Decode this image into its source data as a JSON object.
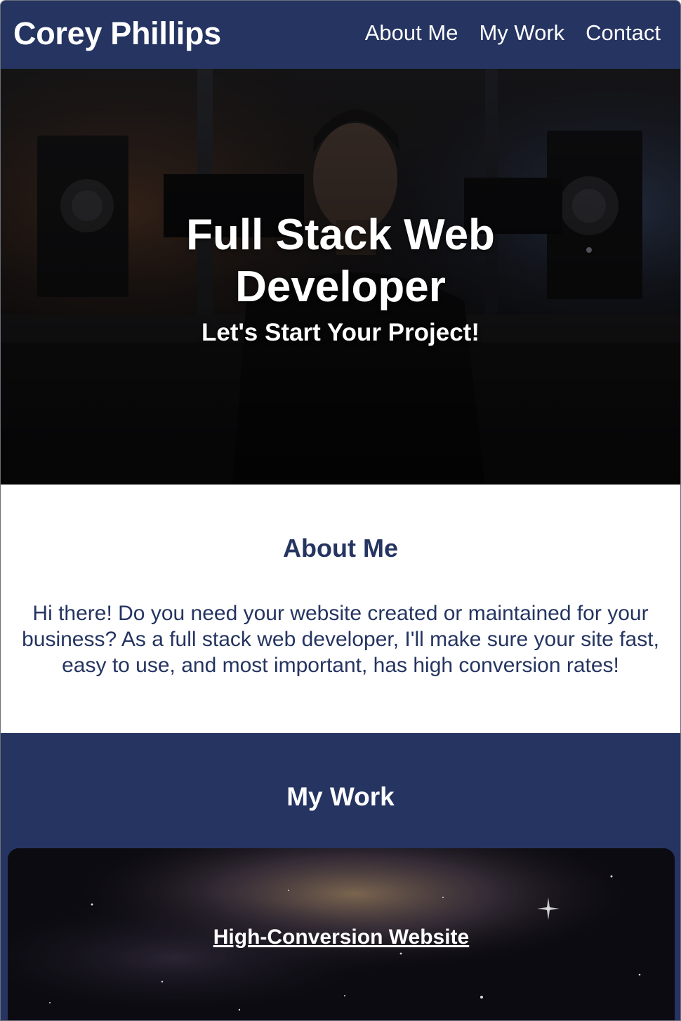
{
  "header": {
    "brand": "Corey Phillips",
    "nav": [
      "About Me",
      "My Work",
      "Contact"
    ]
  },
  "hero": {
    "title": "Full Stack Web Developer",
    "subtitle": "Let's Start Your Project!"
  },
  "about": {
    "heading": "About Me",
    "body": "Hi there! Do you need your website created or maintained for your business? As a full stack web developer, I'll make sure your site fast, easy to use, and most important, has high conversion rates!"
  },
  "work": {
    "heading": "My Work",
    "projects": [
      {
        "title": "High-Conversion Website"
      }
    ]
  },
  "colors": {
    "primary": "#253461",
    "text_light": "#ffffff"
  }
}
